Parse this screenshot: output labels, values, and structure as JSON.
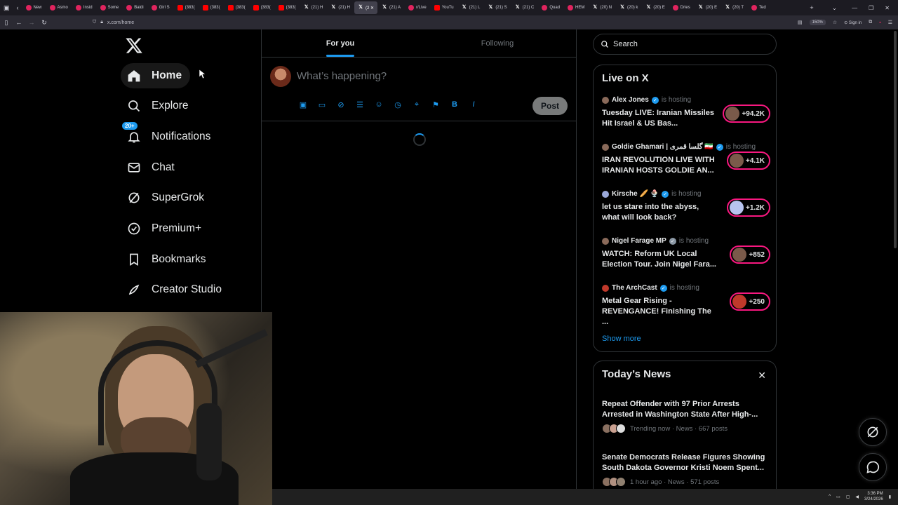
{
  "browser": {
    "tabs": [
      {
        "label": "",
        "fav": "x"
      },
      {
        "label": "New",
        "fav": "red"
      },
      {
        "label": "Asmo",
        "fav": "red"
      },
      {
        "label": "Insid",
        "fav": "red"
      },
      {
        "label": "Some",
        "fav": "red"
      },
      {
        "label": "Baldi",
        "fav": "red"
      },
      {
        "label": "Girl S",
        "fav": "red"
      },
      {
        "label": "(383(",
        "fav": "yt"
      },
      {
        "label": "(383(",
        "fav": "yt"
      },
      {
        "label": "(383(",
        "fav": "yt"
      },
      {
        "label": "(383(",
        "fav": "yt"
      },
      {
        "label": "(383(",
        "fav": "yt"
      },
      {
        "label": "(21) H",
        "fav": "x"
      },
      {
        "label": "(21) H",
        "fav": "x"
      },
      {
        "label": "(2 ✕",
        "fav": "x",
        "active": true
      },
      {
        "label": "(21) A",
        "fav": "x"
      },
      {
        "label": "r/Live",
        "fav": "red"
      },
      {
        "label": "YouTu",
        "fav": "yt"
      },
      {
        "label": "(21) L",
        "fav": "x"
      },
      {
        "label": "(21) S",
        "fav": "x"
      },
      {
        "label": "(21) C",
        "fav": "x"
      },
      {
        "label": "Quad",
        "fav": "red"
      },
      {
        "label": "HEM",
        "fav": "red"
      },
      {
        "label": "(20) N",
        "fav": "x"
      },
      {
        "label": "(20) k",
        "fav": "x"
      },
      {
        "label": "(20) E",
        "fav": "x"
      },
      {
        "label": "Dries",
        "fav": "red"
      },
      {
        "label": "(20) E",
        "fav": "x"
      },
      {
        "label": "(20) T",
        "fav": "x"
      },
      {
        "label": "Ted",
        "fav": "red"
      }
    ],
    "url": "x.com/home",
    "zoom": "150%",
    "sign_in": "Sign in",
    "window_controls": [
      "—",
      "❐",
      "✕"
    ]
  },
  "sidebar": {
    "items": [
      {
        "label": "Home",
        "icon": "home-icon"
      },
      {
        "label": "Explore",
        "icon": "search-icon"
      },
      {
        "label": "Notifications",
        "icon": "bell-icon",
        "badge": "20+"
      },
      {
        "label": "Chat",
        "icon": "mail-icon"
      },
      {
        "label": "SuperGrok",
        "icon": "grok-icon"
      },
      {
        "label": "Premium+",
        "icon": "verified-icon"
      },
      {
        "label": "Bookmarks",
        "icon": "bookmark-icon"
      },
      {
        "label": "Creator Studio",
        "icon": "rocket-icon"
      }
    ]
  },
  "timeline": {
    "tabs": [
      "For you",
      "Following"
    ],
    "composer_placeholder": "What’s happening?",
    "post_label": "Post"
  },
  "search": {
    "placeholder": "Search"
  },
  "live": {
    "title": "Live on X",
    "items": [
      {
        "host": "Alex Jones",
        "status": "is hosting",
        "title": "Tuesday LIVE: Iranian Missiles Hit Israel & US Bas...",
        "count": "+94.2K"
      },
      {
        "host": "Goldie Ghamari | گلسا قمری 🇮🇷",
        "status": "is hosting",
        "title": "IRAN REVOLUTION LIVE WITH IRANIAN HOSTS GOLDIE AN...",
        "count": "+4.1K"
      },
      {
        "host": "Kirsche 🥖 🍨",
        "status": "is hosting",
        "title": "let us stare into the abyss, what will look back?",
        "count": "+1.2K"
      },
      {
        "host": "Nigel Farage MP",
        "status": "is hosting",
        "title": "WATCH: Reform UK Local Election Tour. Join Nigel Fara...",
        "count": "+852"
      },
      {
        "host": "The ArchCast",
        "status": "is hosting",
        "title": "Metal Gear Rising - REVENGANCE! Finishing The ...",
        "count": "+250"
      }
    ],
    "show_more": "Show more"
  },
  "news": {
    "title": "Today’s News",
    "close": "✕",
    "items": [
      {
        "title": "Repeat Offender with 97 Prior Arrests Arrested in Washington State After High-...",
        "meta": "Trending now · News · 667 posts"
      },
      {
        "title": "Senate Democrats Release Figures Showing South Dakota Governor Kristi Noem Spent...",
        "meta": "1 hour ago · News · 571 posts"
      }
    ]
  },
  "taskbar": {
    "time": "3:36 PM",
    "date": "3/24/2026"
  },
  "colors": {
    "accent": "#1d9bf0",
    "live": "#f91880",
    "bg": "#000000",
    "border": "#2f3336"
  }
}
